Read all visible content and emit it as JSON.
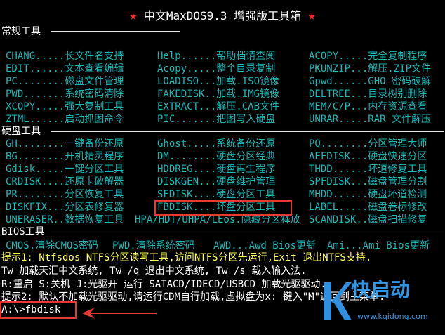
{
  "title": {
    "star": "★",
    "text": "中文MaxDOS9.3 增强版工具箱"
  },
  "sections": {
    "general": "常规工具",
    "disk": "硬盘工具",
    "bios": "BIOS工具"
  },
  "general_rows": [
    [
      {
        "cmd": "CHANG.....",
        "desc": "长文件名支持"
      },
      {
        "cmd": "Help......",
        "desc": "帮助档请查阅"
      },
      {
        "cmd": "ACOPY.....",
        "desc": "完全复制程序"
      }
    ],
    [
      {
        "cmd": "EDIT......",
        "desc": "文本查看编辑"
      },
      {
        "cmd": "Acopy.....",
        "desc": "整个目录复制"
      },
      {
        "cmd": "PKUNZIP...",
        "desc": "解压.ZIP文件"
      }
    ],
    [
      {
        "cmd": "PC........",
        "desc": "磁盘文件管理"
      },
      {
        "cmd": "LOADISO...",
        "desc": "加载.ISO镜像"
      },
      {
        "cmd": "Gpwd......",
        "desc": "GHO 密码破解"
      }
    ],
    [
      {
        "cmd": "PWD.......",
        "desc": "系统密码清除"
      },
      {
        "cmd": "FAKEDISK..",
        "desc": "加载.IMG镜像"
      },
      {
        "cmd": "DELTREE...",
        "desc": "目录树别删除"
      }
    ],
    [
      {
        "cmd": "XCOPY.....",
        "desc": "强大复制工具"
      },
      {
        "cmd": "EXTRACT...",
        "desc": "解压.CAB文件"
      },
      {
        "cmd": "MEM/C/P...",
        "desc": "内存资源查看"
      }
    ],
    [
      {
        "cmd": "ZTML......",
        "desc": "启动抓图命令"
      },
      {
        "cmd": "PIC.......",
        "desc": "把图写入硬盘"
      },
      {
        "cmd": "UNRAR.....",
        "desc": "RAR 文件解压"
      }
    ]
  ],
  "disk_rows": [
    [
      {
        "cmd": "GH........",
        "desc": "一键备份还原"
      },
      {
        "cmd": "Ghost.....",
        "desc": "系统备份还原"
      },
      {
        "cmd": "PQ........",
        "desc": "分区管理大师"
      }
    ],
    [
      {
        "cmd": "BG........",
        "desc": "开机精灵程序"
      },
      {
        "cmd": "DM........",
        "desc": "硬盘分区经典"
      },
      {
        "cmd": "AEFDISK...",
        "desc": "硬盘快速分区"
      }
    ],
    [
      {
        "cmd": "Gdisk.....",
        "desc": "一键分区工具"
      },
      {
        "cmd": "HDDREG....",
        "desc": "硬盘再生程序"
      },
      {
        "cmd": "THDD......",
        "desc": "坏道修复工具"
      }
    ],
    [
      {
        "cmd": "CRDISK....",
        "desc": "还原卡破解器"
      },
      {
        "cmd": "DISKGEN...",
        "desc": "硬盘维护管理"
      },
      {
        "cmd": "SPFDISK...",
        "desc": "磁盘管理分割"
      }
    ],
    [
      {
        "cmd": "PR........",
        "desc": "分区恢复工具"
      },
      {
        "cmd": "SFDISK....",
        "desc": "硬盘分区工具"
      },
      {
        "cmd": "MHDD......",
        "desc": "硬盘坏道检测"
      }
    ],
    [
      {
        "cmd": "DISKFIX...",
        "desc": "分区表修复器"
      },
      {
        "cmd": "FBDISK....",
        "desc": "坏盘分区工具"
      },
      {
        "cmd": "LABEL.....",
        "desc": "磁盘卷标修改"
      }
    ],
    [
      {
        "cmd": "UNERASER..",
        "desc": "数据恢复工具"
      },
      {
        "cmd": "HPA/HDT/UHPA/LEos.",
        "desc": "隐藏分区释放"
      },
      {
        "cmd": "SCANDISK..",
        "desc": "磁盘扫描修复"
      }
    ]
  ],
  "bios_row": [
    {
      "cmd": "CMOS.",
      "desc": "清除CMOS密码"
    },
    {
      "cmd": "PWD.",
      "desc": "清除系统密码"
    },
    {
      "cmd": "AWD...",
      "desc": "Awd Bios更新"
    },
    {
      "cmd": "Ami...",
      "desc": "Ami Bios更新"
    }
  ],
  "tips": {
    "tip1": "提示1: Ntfsdos  NTFS分区读写工具,访问NTFS分区先运行,Exit 退出NTFS支持.",
    "tw": " Tw  加载天汇中文系统, Tw /q 退出中文系统,  Tw /s 载入输入法.",
    "reboot": " R:重启   S:关机    J:光驱开    运行 SATACD/IDECD/USBCD 加载光驱驱动.",
    "tip2": "提示2: 默认不加载光驱驱动,请运行CDM自行加载,虚拟盘为x:  键入\"M\"返回到主菜单."
  },
  "prompt": {
    "path": "A:\\>",
    "command": "fbdisk"
  },
  "watermark": {
    "brand": "快启动",
    "url": "www.kqidong.com"
  },
  "colors": {
    "cyan": "#17b8b8",
    "yellow": "#ffff55",
    "red": "#e53935",
    "blue": "#35a7ff"
  }
}
